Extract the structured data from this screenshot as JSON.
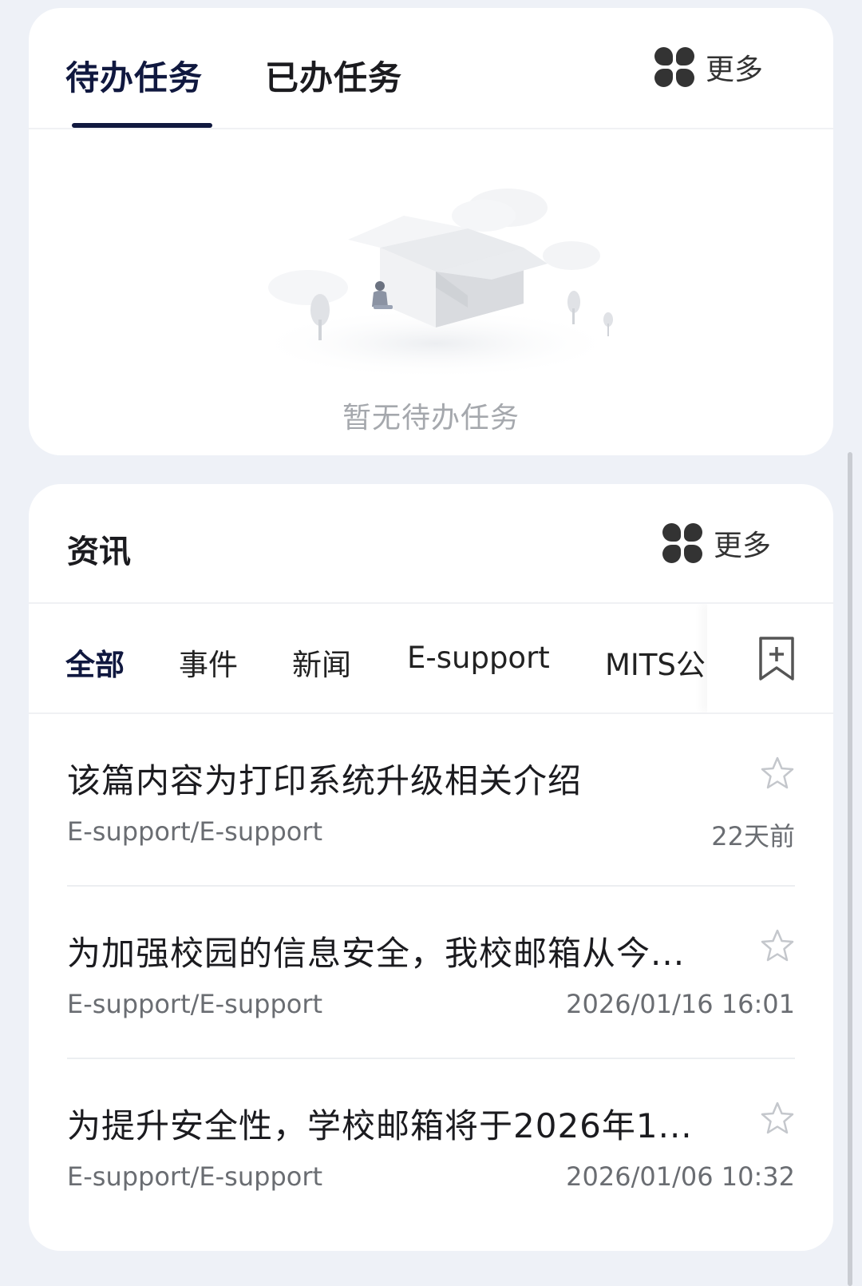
{
  "tasks": {
    "tabs": [
      "待办任务",
      "已办任务"
    ],
    "more_label": "更多",
    "empty_text": "暂无待办任务",
    "icons": {
      "more": "grid-icon"
    }
  },
  "news": {
    "title": "资讯",
    "more_label": "更多",
    "filters": [
      "全部",
      "事件",
      "新闻",
      "E-support",
      "MITS公"
    ],
    "active_filter": "全部",
    "items": [
      {
        "headline": "该篇内容为打印系统升级相关介绍",
        "source": "E-support/E-support",
        "time": "22天前"
      },
      {
        "headline": "为加强校园的信息安全，我校邮箱从今...",
        "source": "E-support/E-support",
        "time": "2026/01/16 16:01"
      },
      {
        "headline": "为提升安全性，学校邮箱将于2026年1...",
        "source": "E-support/E-support",
        "time": "2026/01/06 10:32"
      }
    ],
    "icons": {
      "bookmark": "bookmark-add-icon",
      "star": "star-outline-icon"
    }
  },
  "colors": {
    "accent": "#10183f",
    "background": "#eef1f7",
    "muted": "#a5a8ad"
  }
}
